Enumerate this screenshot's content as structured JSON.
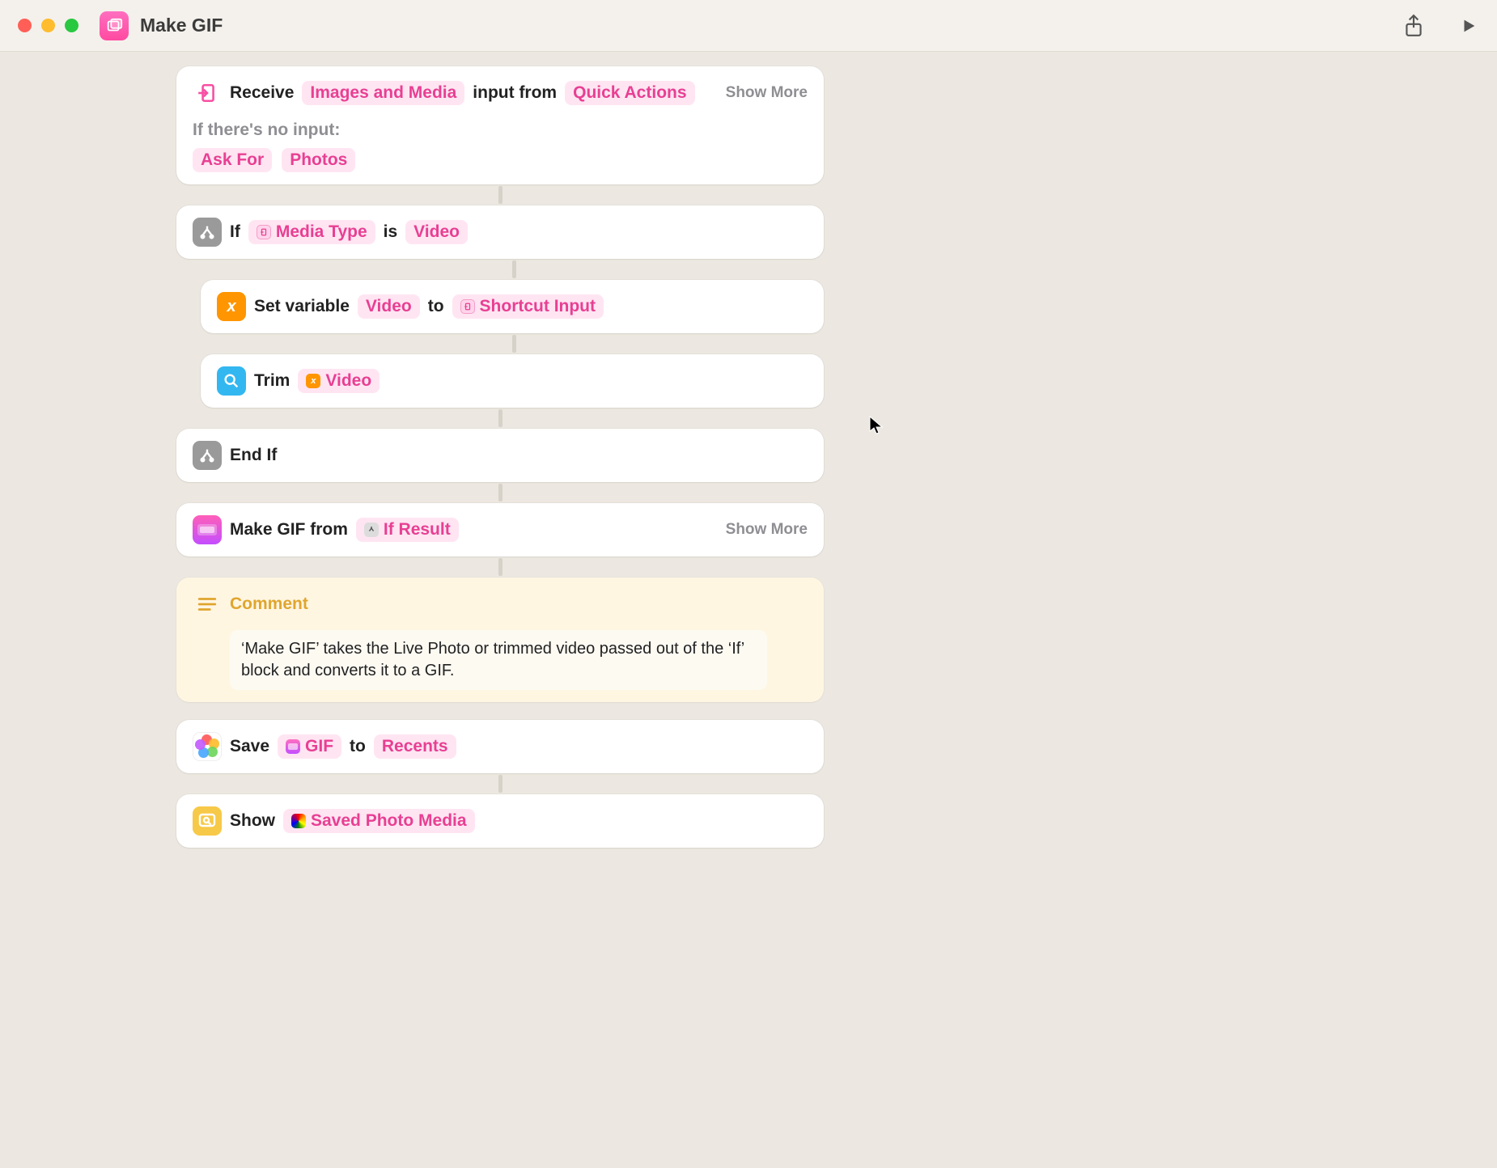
{
  "titlebar": {
    "shortcut_name": "Make GIF"
  },
  "actions": {
    "receive": {
      "label_receive": "Receive",
      "input_type": "Images and Media",
      "label_from": "input from",
      "source": "Quick Actions",
      "show_more": "Show More",
      "no_input_label": "If there's no input:",
      "fallback_action": "Ask For",
      "fallback_param": "Photos"
    },
    "if": {
      "label_if": "If",
      "variable": "Media Type",
      "comparator": "is",
      "value": "Video"
    },
    "set_var": {
      "label": "Set variable",
      "name": "Video",
      "to": "to",
      "value": "Shortcut Input"
    },
    "trim": {
      "label": "Trim",
      "target": "Video"
    },
    "end_if": {
      "label": "End If"
    },
    "make_gif": {
      "label": "Make GIF from",
      "source": "If Result",
      "show_more": "Show More"
    },
    "comment": {
      "title": "Comment",
      "body": "‘Make GIF’ takes the Live Photo or trimmed video passed out of the ‘If’ block and converts it to a GIF."
    },
    "save": {
      "label": "Save",
      "item": "GIF",
      "to": "to",
      "album": "Recents"
    },
    "show": {
      "label": "Show",
      "item": "Saved Photo Media"
    }
  }
}
